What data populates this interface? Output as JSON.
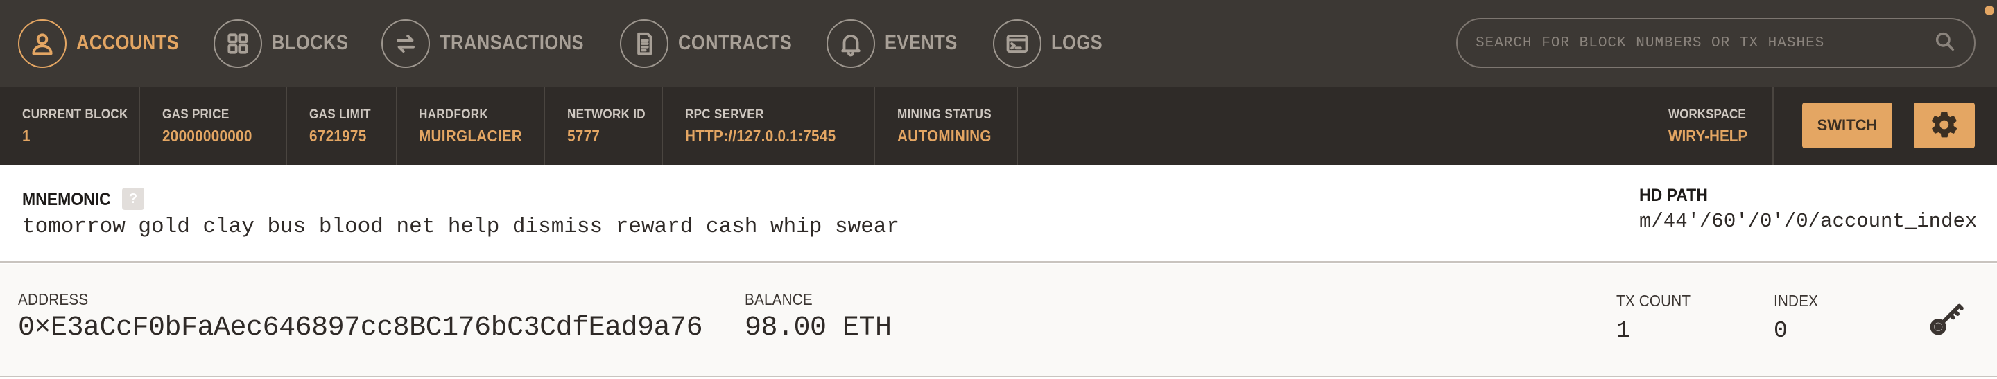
{
  "nav": {
    "items": [
      {
        "label": "ACCOUNTS",
        "icon": "account-icon",
        "active": true
      },
      {
        "label": "BLOCKS",
        "icon": "blocks-icon",
        "active": false
      },
      {
        "label": "TRANSACTIONS",
        "icon": "transactions-icon",
        "active": false
      },
      {
        "label": "CONTRACTS",
        "icon": "contracts-icon",
        "active": false
      },
      {
        "label": "EVENTS",
        "icon": "bell-icon",
        "active": false
      },
      {
        "label": "LOGS",
        "icon": "terminal-icon",
        "active": false
      }
    ],
    "search_placeholder": "SEARCH FOR BLOCK NUMBERS OR TX HASHES"
  },
  "status": {
    "current_block": {
      "label": "CURRENT BLOCK",
      "value": "1"
    },
    "gas_price": {
      "label": "GAS PRICE",
      "value": "20000000000"
    },
    "gas_limit": {
      "label": "GAS LIMIT",
      "value": "6721975"
    },
    "hardfork": {
      "label": "HARDFORK",
      "value": "MUIRGLACIER"
    },
    "network_id": {
      "label": "NETWORK ID",
      "value": "5777"
    },
    "rpc_server": {
      "label": "RPC SERVER",
      "value": "HTTP://127.0.0.1:7545"
    },
    "mining_status": {
      "label": "MINING STATUS",
      "value": "AUTOMINING"
    },
    "workspace": {
      "label": "WORKSPACE",
      "value": "WIRY-HELP"
    },
    "switch_label": "SWITCH"
  },
  "mnemonic": {
    "title": "MNEMONIC",
    "help": "?",
    "words": "tomorrow gold clay bus blood net help dismiss reward cash whip swear",
    "hd_path_title": "HD PATH",
    "hd_path": "m/44'/60'/0'/0/account_index"
  },
  "account": {
    "address_label": "ADDRESS",
    "address": "0×E3aCcF0bFaAec646897cc8BC176bC3CdfEad9a76",
    "balance_label": "BALANCE",
    "balance": "98.00 ETH",
    "tx_count_label": "TX COUNT",
    "tx_count": "1",
    "index_label": "INDEX",
    "index": "0"
  },
  "colors": {
    "accent": "#e4a663",
    "nav_bg": "#3c3834",
    "status_bg": "#2f2b28"
  }
}
